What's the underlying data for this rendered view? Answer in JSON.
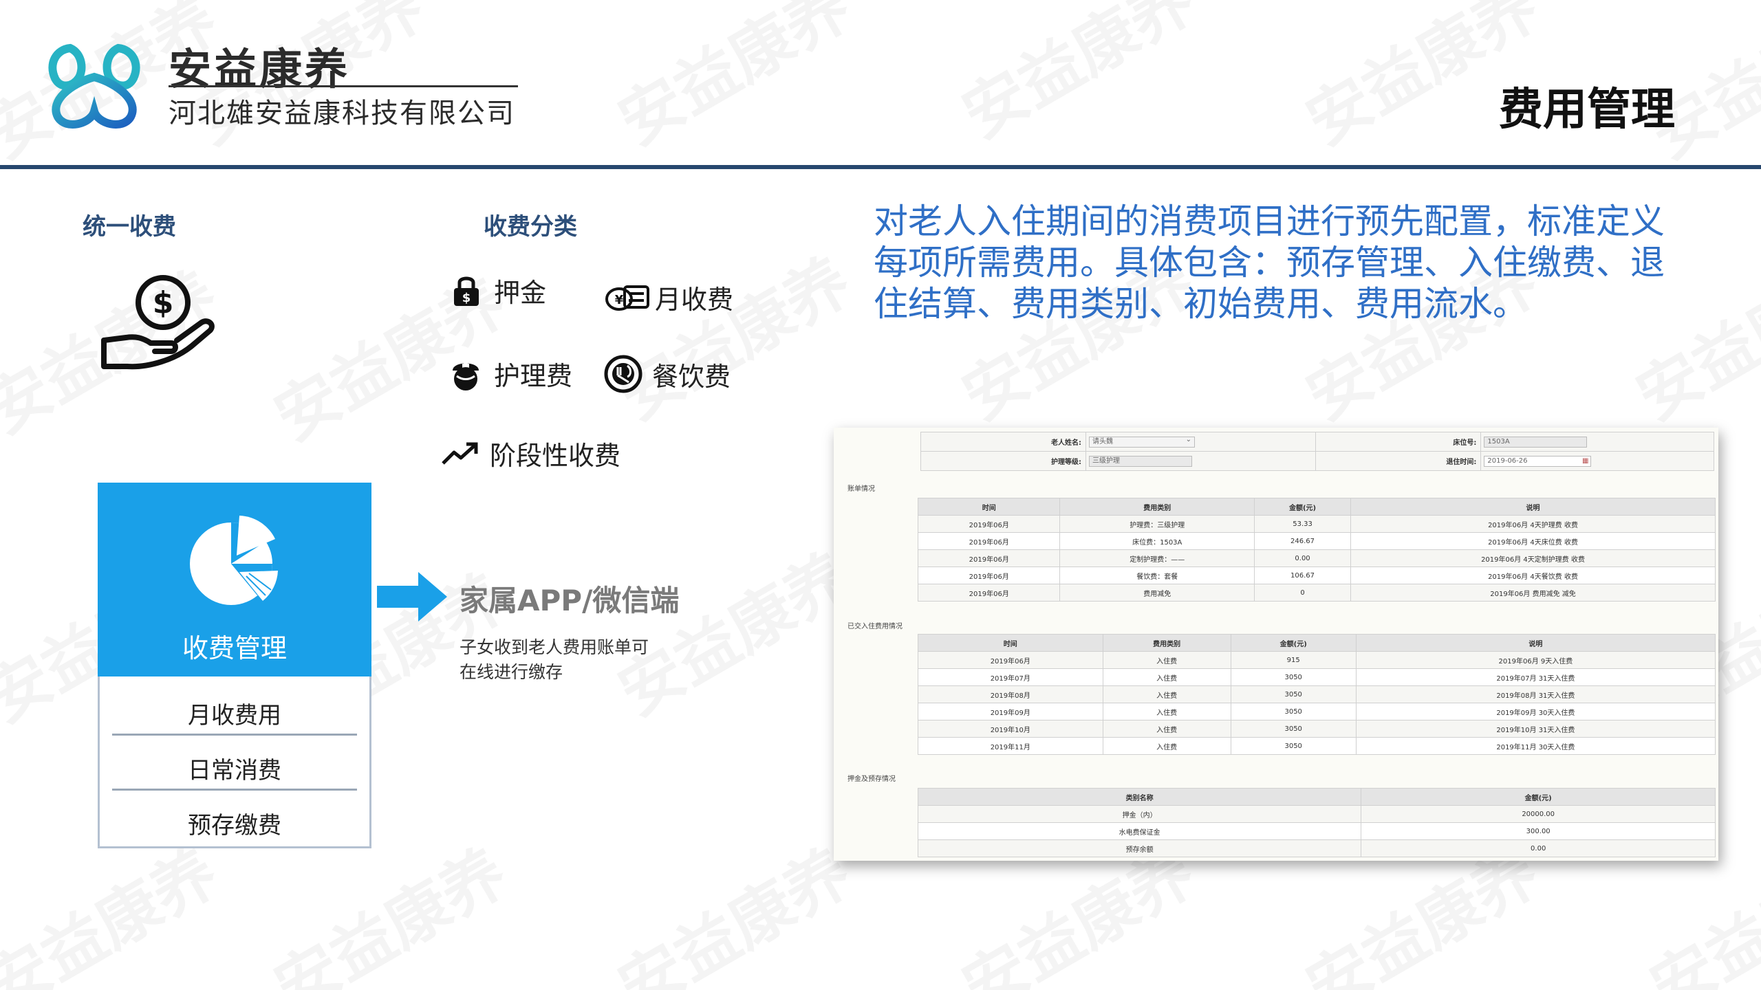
{
  "watermark": "安益康养",
  "header": {
    "brand": "安益康养",
    "company": "河北雄安益康科技有限公司",
    "title": "费用管理"
  },
  "left": {
    "unified_title": "统一收费",
    "categories_title": "收费分类",
    "categories": [
      {
        "label": "押金",
        "icon": "padlock-icon"
      },
      {
        "label": "月收费",
        "icon": "money-card-icon"
      },
      {
        "label": "护理费",
        "icon": "nurse-icon"
      },
      {
        "label": "餐饮费",
        "icon": "meal-icon"
      },
      {
        "label": "阶段性收费",
        "icon": "trend-up-icon"
      }
    ],
    "fee_box": {
      "title": "收费管理",
      "items": [
        "月收费用",
        "日常消费",
        "预存缴费"
      ]
    },
    "app": {
      "title": "家属APP/微信端",
      "desc_line1": "子女收到老人费用账单可",
      "desc_line2": "在线进行缴存"
    }
  },
  "description": "对老人入住期间的消费项目进行预先配置，标准定义每项所需费用。具体包含：预存管理、入住缴费、退住结算、费用类别、初始费用、费用流水。",
  "screenshot": {
    "form": {
      "elder_name_label": "老人姓名:",
      "elder_name_value": "请头魏",
      "bed_label": "床位号:",
      "bed_value": "1503A",
      "care_level_label": "护理等级:",
      "care_level_value": "三级护理",
      "checkout_label": "退住时间:",
      "checkout_value": "2019-06-26"
    },
    "bill": {
      "group_label": "账单情况",
      "headers": [
        "时间",
        "费用类别",
        "金额(元)",
        "说明"
      ],
      "rows": [
        [
          "2019年06月",
          "护理费：三级护理",
          "53.33",
          "2019年06月 4天护理费 收费"
        ],
        [
          "2019年06月",
          "床位费：1503A",
          "246.67",
          "2019年06月 4天床位费 收费"
        ],
        [
          "2019年06月",
          "定制护理费：——",
          "0.00",
          "2019年06月 4天定制护理费 收费"
        ],
        [
          "2019年06月",
          "餐饮费：套餐",
          "106.67",
          "2019年06月 4天餐饮费 收费"
        ],
        [
          "2019年06月",
          "费用减免",
          "0",
          "2019年06月 费用减免 减免"
        ]
      ]
    },
    "paid": {
      "group_label": "已交入住费用情况",
      "headers": [
        "时间",
        "费用类别",
        "金额(元)",
        "说明"
      ],
      "rows": [
        [
          "2019年06月",
          "入住费",
          "915",
          "2019年06月 9天入住费"
        ],
        [
          "2019年07月",
          "入住费",
          "3050",
          "2019年07月 31天入住费"
        ],
        [
          "2019年08月",
          "入住费",
          "3050",
          "2019年08月 31天入住费"
        ],
        [
          "2019年09月",
          "入住费",
          "3050",
          "2019年09月 30天入住费"
        ],
        [
          "2019年10月",
          "入住费",
          "3050",
          "2019年10月 31天入住费"
        ],
        [
          "2019年11月",
          "入住费",
          "3050",
          "2019年11月 30天入住费"
        ]
      ]
    },
    "deposit": {
      "group_label": "押金及预存情况",
      "headers": [
        "类别名称",
        "金额(元)"
      ],
      "rows": [
        [
          "押金（内）",
          "20000.00"
        ],
        [
          "水电费保证金",
          "300.00"
        ],
        [
          "预存余额",
          "0.00"
        ]
      ]
    }
  },
  "colors": {
    "header_bar": "#27476e",
    "section_title": "#2d4f7a",
    "accent_blue": "#1aa0e8",
    "description_blue": "#2f6fc6",
    "app_title_gray": "#7a7a7a"
  }
}
